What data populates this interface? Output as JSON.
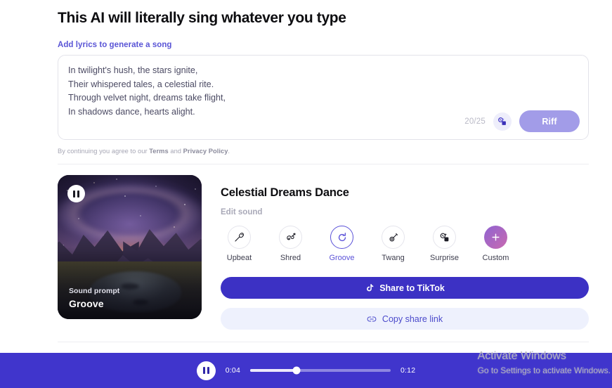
{
  "headline": "This AI will literally sing whatever you type",
  "lyrics_section": {
    "label": "Add lyrics to generate a song",
    "lines": [
      "In twilight's hush, the stars ignite,",
      "Their whispered tales, a celestial rite.",
      "Through velvet night, dreams take flight,",
      "In shadows dance, hearts alight."
    ],
    "char_count": "20/25",
    "magic_icon": "magic-wand-icon",
    "submit_label": "Riff"
  },
  "terms": {
    "prefix": "By continuing you agree to our ",
    "terms_link": "Terms",
    "middle": " and ",
    "privacy_link": "Privacy Policy",
    "suffix": "."
  },
  "result": {
    "artwork": {
      "pause_icon": "pause-icon",
      "prompt_label": "Sound prompt",
      "prompt_value": "Groove"
    },
    "song_title": "Celestial Dreams Dance",
    "edit_sound_label": "Edit sound",
    "styles": [
      {
        "label": "Upbeat",
        "icon": "microphone-icon",
        "selected": false
      },
      {
        "label": "Shred",
        "icon": "electric-guitar-icon",
        "selected": false
      },
      {
        "label": "Groove",
        "icon": "refresh-circle-icon",
        "selected": true
      },
      {
        "label": "Twang",
        "icon": "banjo-icon",
        "selected": false
      },
      {
        "label": "Surprise",
        "icon": "magic-wand-icon",
        "selected": false
      },
      {
        "label": "Custom",
        "icon": "plus-icon",
        "selected": false
      }
    ],
    "share_button": {
      "label": "Share to TikTok",
      "icon": "tiktok-icon"
    },
    "copy_button": {
      "label": "Copy share link",
      "icon": "link-icon"
    }
  },
  "player": {
    "play_state_icon": "pause-icon",
    "current_time": "0:04",
    "total_time": "0:12",
    "progress_percent": 33
  },
  "watermark": {
    "line1": "Activate Windows",
    "line2": "Go to Settings to activate Windows."
  },
  "colors": {
    "accent": "#4035cc",
    "accent_soft": "#a29ce8",
    "link": "#5a55d6",
    "selected": "#5b52d8",
    "copy_bg": "#eef1fd"
  }
}
